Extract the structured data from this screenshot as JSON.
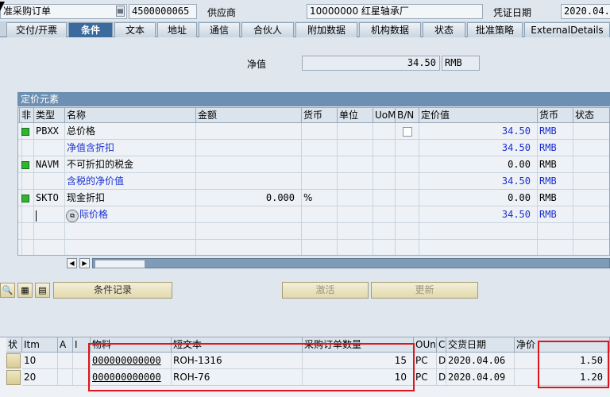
{
  "header": {
    "doc_type_value": "准采购订单",
    "po_number": "4500000065",
    "vendor_label": "供应商",
    "vendor_value": "10000000 红星轴承厂",
    "doc_date_label": "凭证日期",
    "doc_date_value": "2020.04."
  },
  "tabs": [
    {
      "label": "交付/开票"
    },
    {
      "label": "条件"
    },
    {
      "label": "文本"
    },
    {
      "label": "地址"
    },
    {
      "label": "通信"
    },
    {
      "label": "合伙人"
    },
    {
      "label": "附加数据"
    },
    {
      "label": "机构数据"
    },
    {
      "label": "状态"
    },
    {
      "label": "批准策略"
    },
    {
      "label": "ExternalDetails"
    }
  ],
  "active_tab": "条件",
  "net_value": {
    "label": "净值",
    "amount": "34.50",
    "currency": "RMB"
  },
  "pricing": {
    "title": "定价元素",
    "columns": [
      "非",
      "类型",
      "名称",
      "金额",
      "货币",
      "单位",
      "UoM",
      "B/N",
      "定价值",
      "货币",
      "状态"
    ],
    "rows": [
      {
        "led": true,
        "type": "PBXX",
        "name": "总价格",
        "amount": "",
        "currency": "",
        "bn_checkbox": true,
        "value": "34.50",
        "vcur": "RMB",
        "blue": false
      },
      {
        "led": false,
        "type": "",
        "name": "净值含折扣",
        "amount": "",
        "currency": "",
        "bn_checkbox": false,
        "value": "34.50",
        "vcur": "RMB",
        "blue": true
      },
      {
        "led": true,
        "type": "NAVM",
        "name": "不可折扣的税金",
        "amount": "",
        "currency": "",
        "bn_checkbox": false,
        "value": "0.00",
        "vcur": "RMB",
        "blue": false
      },
      {
        "led": false,
        "type": "",
        "name": "含税的净价值",
        "amount": "",
        "currency": "",
        "bn_checkbox": false,
        "value": "34.50",
        "vcur": "RMB",
        "blue": true
      },
      {
        "led": true,
        "type": "SKTO",
        "name": "现金折扣",
        "amount": "0.000",
        "currency": "%",
        "bn_checkbox": false,
        "value": "0.00",
        "vcur": "RMB",
        "blue": false
      },
      {
        "led": false,
        "type": "",
        "name": "际价格",
        "amount": "",
        "currency": "",
        "bn_checkbox": false,
        "value": "34.50",
        "vcur": "RMB",
        "blue": true
      }
    ]
  },
  "buttons": {
    "condition_record": "条件记录",
    "activate": "激活",
    "update": "更新"
  },
  "items": {
    "columns": [
      "状",
      "Itm",
      "A",
      "I",
      "物料",
      "短文本",
      "采购订单数量",
      "OUn",
      "C",
      "交货日期",
      "净价"
    ],
    "rows": [
      {
        "itm": "10",
        "material": "000000000000",
        "short_text": "ROH-1316",
        "qty": "15",
        "oun": "PC",
        "c": "D",
        "date": "2020.04.06",
        "net_price": "1.50"
      },
      {
        "itm": "20",
        "material": "000000000000",
        "short_text": "ROH-76",
        "qty": "10",
        "oun": "PC",
        "c": "D",
        "date": "2020.04.09",
        "net_price": "1.20"
      }
    ]
  },
  "colors": {
    "highlight_box": "#e0141a",
    "active_tab": "#3b6b9c",
    "link_blue": "#1a2fcf",
    "status_green": "#2fb52f"
  }
}
